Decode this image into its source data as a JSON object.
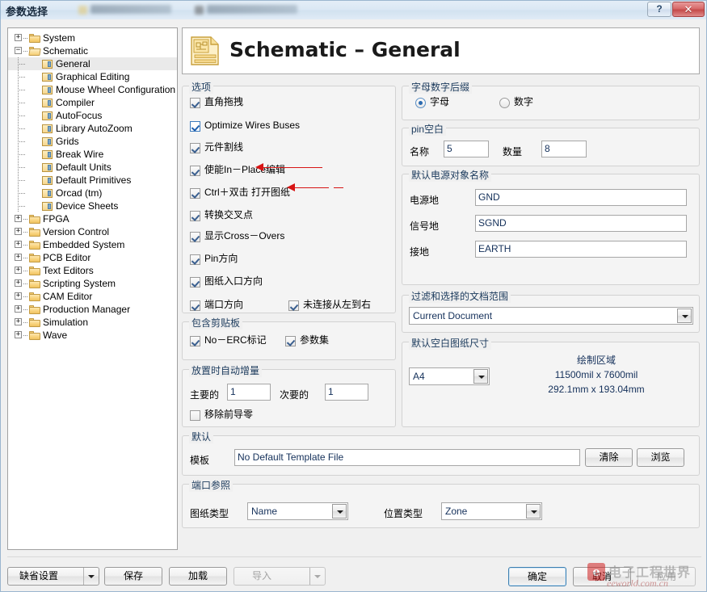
{
  "window": {
    "title": "参数选择",
    "help_button": "?",
    "close_button": "✕"
  },
  "tree": {
    "nodes": [
      {
        "label": "System",
        "level": 0,
        "type": "folder",
        "expander": "+",
        "selected": false
      },
      {
        "label": "Schematic",
        "level": 0,
        "type": "folder-open",
        "expander": "−",
        "selected": false
      },
      {
        "label": "General",
        "level": 1,
        "type": "leaf",
        "expander": "",
        "selected": true
      },
      {
        "label": "Graphical Editing",
        "level": 1,
        "type": "leaf",
        "expander": "",
        "selected": false
      },
      {
        "label": "Mouse Wheel Configuration",
        "level": 1,
        "type": "leaf",
        "expander": "",
        "selected": false
      },
      {
        "label": "Compiler",
        "level": 1,
        "type": "leaf",
        "expander": "",
        "selected": false
      },
      {
        "label": "AutoFocus",
        "level": 1,
        "type": "leaf",
        "expander": "",
        "selected": false
      },
      {
        "label": "Library AutoZoom",
        "level": 1,
        "type": "leaf",
        "expander": "",
        "selected": false
      },
      {
        "label": "Grids",
        "level": 1,
        "type": "leaf",
        "expander": "",
        "selected": false
      },
      {
        "label": "Break Wire",
        "level": 1,
        "type": "leaf",
        "expander": "",
        "selected": false
      },
      {
        "label": "Default Units",
        "level": 1,
        "type": "leaf",
        "expander": "",
        "selected": false
      },
      {
        "label": "Default Primitives",
        "level": 1,
        "type": "leaf",
        "expander": "",
        "selected": false
      },
      {
        "label": "Orcad (tm)",
        "level": 1,
        "type": "leaf",
        "expander": "",
        "selected": false
      },
      {
        "label": "Device Sheets",
        "level": 1,
        "type": "leaf",
        "expander": "",
        "selected": false
      },
      {
        "label": "FPGA",
        "level": 0,
        "type": "folder",
        "expander": "+",
        "selected": false
      },
      {
        "label": "Version Control",
        "level": 0,
        "type": "folder",
        "expander": "+",
        "selected": false
      },
      {
        "label": "Embedded System",
        "level": 0,
        "type": "folder",
        "expander": "+",
        "selected": false
      },
      {
        "label": "PCB Editor",
        "level": 0,
        "type": "folder",
        "expander": "+",
        "selected": false
      },
      {
        "label": "Text Editors",
        "level": 0,
        "type": "folder",
        "expander": "+",
        "selected": false
      },
      {
        "label": "Scripting System",
        "level": 0,
        "type": "folder",
        "expander": "+",
        "selected": false
      },
      {
        "label": "CAM Editor",
        "level": 0,
        "type": "folder",
        "expander": "+",
        "selected": false
      },
      {
        "label": "Production Manager",
        "level": 0,
        "type": "folder",
        "expander": "+",
        "selected": false
      },
      {
        "label": "Simulation",
        "level": 0,
        "type": "folder",
        "expander": "+",
        "selected": false
      },
      {
        "label": "Wave",
        "level": 0,
        "type": "folder",
        "expander": "+",
        "selected": false
      }
    ]
  },
  "header": {
    "title": "Schematic – General",
    "icon": "schematic-document-icon"
  },
  "options": {
    "group_title": "选项",
    "items": [
      {
        "label": "直角拖拽",
        "checked": true,
        "focused": false
      },
      {
        "label": "Optimize Wires Buses",
        "checked": true,
        "focused": true
      },
      {
        "label": "元件割线",
        "checked": true,
        "focused": false
      },
      {
        "label": "使能In－Place编辑",
        "checked": true,
        "focused": false
      },
      {
        "label": "Ctrl＋双击 打开图纸",
        "checked": true,
        "focused": false
      },
      {
        "label": "转换交叉点",
        "checked": true,
        "focused": false
      },
      {
        "label": "显示Cross－Overs",
        "checked": true,
        "focused": false
      },
      {
        "label": "Pin方向",
        "checked": true,
        "focused": false
      },
      {
        "label": "图纸入口方向",
        "checked": true,
        "focused": false
      },
      {
        "label": "端口方向",
        "checked": true,
        "focused": false
      }
    ],
    "right_item": {
      "label": "未连接从左到右",
      "checked": true
    }
  },
  "clipboard": {
    "group_title": "包含剪贴板",
    "items": [
      {
        "label": "No－ERC标记",
        "checked": true
      },
      {
        "label": "参数集",
        "checked": true
      }
    ]
  },
  "auto_increment": {
    "group_title": "放置时自动增量",
    "primary_label": "主要的",
    "primary_value": "1",
    "secondary_label": "次要的",
    "secondary_value": "1",
    "remove_zeros_label": "移除前导零",
    "remove_zeros_checked": false
  },
  "alpha_suffix": {
    "group_title": "字母数字后缀",
    "option_alpha": "字母",
    "option_numeric": "数字",
    "selected": "字母"
  },
  "pin_margin": {
    "group_title": "pin空白",
    "name_label": "名称",
    "name_value": "5",
    "number_label": "数量",
    "number_value": "8"
  },
  "power_objects": {
    "group_title": "默认电源对象名称",
    "rows": [
      {
        "label": "电源地",
        "value": "GND"
      },
      {
        "label": "信号地",
        "value": "SGND"
      },
      {
        "label": "接地",
        "value": "EARTH"
      }
    ]
  },
  "doc_scope": {
    "group_title": "过滤和选择的文档范围",
    "value": "Current Document"
  },
  "sheet_size": {
    "group_title": "默认空白图纸尺寸",
    "value": "A4",
    "draw_area_title": "绘制区域",
    "area_imperial": "11500mil x 7600mil",
    "area_metric": "292.1mm x 193.04mm"
  },
  "defaults": {
    "group_title": "默认",
    "template_label": "模板",
    "template_value": "No Default Template File",
    "clear_button": "清除",
    "browse_button": "浏览"
  },
  "port_ref": {
    "group_title": "端口参照",
    "sheet_type_label": "图纸类型",
    "sheet_type_value": "Name",
    "location_type_label": "位置类型",
    "location_type_value": "Zone"
  },
  "footer": {
    "defaults_button": "缺省设置",
    "save_button": "保存",
    "load_button": "加载",
    "import_button": "导入",
    "ok_button": "确定",
    "cancel_button": "取消",
    "apply_button": "应用"
  },
  "watermark": {
    "logo": "e",
    "line1": "电子工程世界",
    "line2": "eeworld.com.cn"
  },
  "colors": {
    "accent": "#3c7fb1",
    "group_title": "#1b3a5c",
    "annotation_arrow": "#d71414",
    "value_text": "#14305a"
  }
}
